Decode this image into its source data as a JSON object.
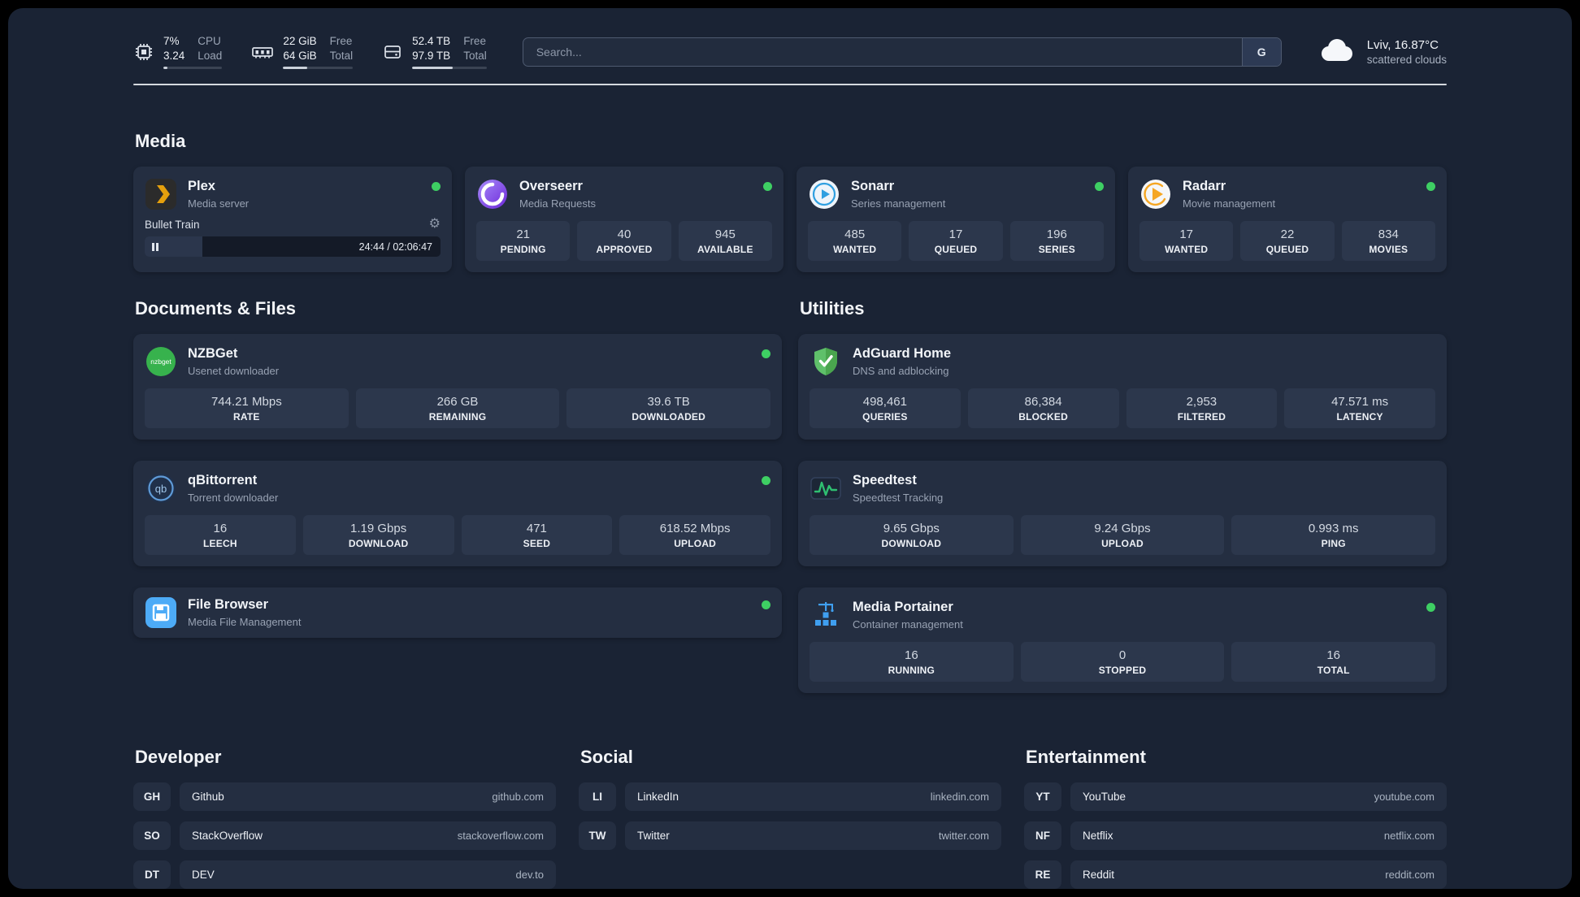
{
  "colors": {
    "panel_bg": "#1a2334",
    "card_bg": "#242e41",
    "tile_bg": "#2c374c",
    "status_online": "#3ecf63",
    "plex_amber": "#e5a00d",
    "adguard_green": "#5fc06a",
    "speedtest_green": "#2fbf71",
    "portainer_blue": "#3f9ff0"
  },
  "topbar": {
    "cpu": {
      "icon": "cpu-icon",
      "value1": "7%",
      "value2": "3.24",
      "label1": "CPU",
      "label2": "Load",
      "progress_pct": 7
    },
    "ram": {
      "icon": "ram-icon",
      "value1": "22 GiB",
      "value2": "64 GiB",
      "label1": "Free",
      "label2": "Total",
      "progress_pct": 34
    },
    "disk": {
      "icon": "disk-icon",
      "value1": "52.4 TB",
      "value2": "97.9 TB",
      "label1": "Free",
      "label2": "Total",
      "progress_pct": 54
    },
    "search": {
      "placeholder": "Search...",
      "engine_button": "G"
    },
    "weather": {
      "icon": "cloud-icon",
      "location": "Lviv, 16.87°C",
      "condition": "scattered clouds"
    }
  },
  "sections": {
    "media": {
      "title": "Media",
      "apps": [
        {
          "name": "Plex",
          "subtitle": "Media server",
          "status": "online",
          "player": {
            "title": "Bullet Train",
            "state": "paused",
            "time": "24:44 / 02:06:47",
            "progress_pct": 19.5
          }
        },
        {
          "name": "Overseerr",
          "subtitle": "Media Requests",
          "status": "online",
          "stats": [
            {
              "value": "21",
              "label": "PENDING"
            },
            {
              "value": "40",
              "label": "APPROVED"
            },
            {
              "value": "945",
              "label": "AVAILABLE"
            }
          ]
        },
        {
          "name": "Sonarr",
          "subtitle": "Series management",
          "status": "online",
          "stats": [
            {
              "value": "485",
              "label": "WANTED"
            },
            {
              "value": "17",
              "label": "QUEUED"
            },
            {
              "value": "196",
              "label": "SERIES"
            }
          ]
        },
        {
          "name": "Radarr",
          "subtitle": "Movie management",
          "status": "online",
          "stats": [
            {
              "value": "17",
              "label": "WANTED"
            },
            {
              "value": "22",
              "label": "QUEUED"
            },
            {
              "value": "834",
              "label": "MOVIES"
            }
          ]
        }
      ]
    },
    "documents": {
      "title": "Documents & Files",
      "apps": [
        {
          "name": "NZBGet",
          "subtitle": "Usenet downloader",
          "status": "online",
          "stats": [
            {
              "value": "744.21 Mbps",
              "label": "RATE"
            },
            {
              "value": "266 GB",
              "label": "REMAINING"
            },
            {
              "value": "39.6 TB",
              "label": "DOWNLOADED"
            }
          ]
        },
        {
          "name": "qBittorrent",
          "subtitle": "Torrent downloader",
          "status": "online",
          "stats": [
            {
              "value": "16",
              "label": "LEECH"
            },
            {
              "value": "1.19 Gbps",
              "label": "DOWNLOAD"
            },
            {
              "value": "471",
              "label": "SEED"
            },
            {
              "value": "618.52 Mbps",
              "label": "UPLOAD"
            }
          ]
        },
        {
          "name": "File Browser",
          "subtitle": "Media File Management",
          "status": "online",
          "stats": []
        }
      ]
    },
    "utilities": {
      "title": "Utilities",
      "apps": [
        {
          "name": "AdGuard Home",
          "subtitle": "DNS and adblocking",
          "stats": [
            {
              "value": "498,461",
              "label": "QUERIES"
            },
            {
              "value": "86,384",
              "label": "BLOCKED"
            },
            {
              "value": "2,953",
              "label": "FILTERED"
            },
            {
              "value": "47.571 ms",
              "label": "LATENCY"
            }
          ]
        },
        {
          "name": "Speedtest",
          "subtitle": "Speedtest Tracking",
          "stats": [
            {
              "value": "9.65 Gbps",
              "label": "DOWNLOAD"
            },
            {
              "value": "9.24 Gbps",
              "label": "UPLOAD"
            },
            {
              "value": "0.993 ms",
              "label": "PING"
            }
          ]
        },
        {
          "name": "Media Portainer",
          "subtitle": "Container management",
          "status": "online",
          "stats": [
            {
              "value": "16",
              "label": "RUNNING"
            },
            {
              "value": "0",
              "label": "STOPPED"
            },
            {
              "value": "16",
              "label": "TOTAL"
            }
          ]
        }
      ]
    }
  },
  "bookmarks": [
    {
      "title": "Developer",
      "items": [
        {
          "abbr": "GH",
          "name": "Github",
          "url": "github.com"
        },
        {
          "abbr": "SO",
          "name": "StackOverflow",
          "url": "stackoverflow.com"
        },
        {
          "abbr": "DT",
          "name": "DEV",
          "url": "dev.to"
        }
      ]
    },
    {
      "title": "Social",
      "items": [
        {
          "abbr": "LI",
          "name": "LinkedIn",
          "url": "linkedin.com"
        },
        {
          "abbr": "TW",
          "name": "Twitter",
          "url": "twitter.com"
        }
      ]
    },
    {
      "title": "Entertainment",
      "items": [
        {
          "abbr": "YT",
          "name": "YouTube",
          "url": "youtube.com"
        },
        {
          "abbr": "NF",
          "name": "Netflix",
          "url": "netflix.com"
        },
        {
          "abbr": "RE",
          "name": "Reddit",
          "url": "reddit.com"
        }
      ]
    }
  ]
}
